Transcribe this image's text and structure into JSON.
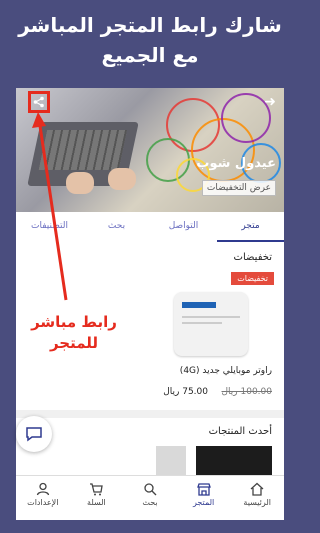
{
  "headline": {
    "line1": "شارك رابط المتجر المباشر",
    "line2": "مع الجميع"
  },
  "banner": {
    "store_name": "عيدول شوب",
    "deals_chip": "عرض التخفيضات"
  },
  "tabs": [
    {
      "label": "متجر",
      "active": true
    },
    {
      "label": "التواصل",
      "active": false
    },
    {
      "label": "بحث",
      "active": false
    },
    {
      "label": "التصنيفات",
      "active": false
    }
  ],
  "discounts": {
    "title": "تخفيضات",
    "badge": "تخفيضات",
    "product_name": "راوتر موبايلي جديد (4G)",
    "price_old": "100.00 ريال",
    "price_new": "75.00 ريال"
  },
  "latest": {
    "title": "أحدث المنتجات"
  },
  "callout": {
    "line1": "رابط مباشر",
    "line2": "للمتجر"
  },
  "bottom_nav": [
    {
      "label": "الرئيسية",
      "icon": "home-icon",
      "active": false
    },
    {
      "label": "المتجر",
      "icon": "store-icon",
      "active": true
    },
    {
      "label": "بحث",
      "icon": "search-icon",
      "active": false
    },
    {
      "label": "السلة",
      "icon": "cart-icon",
      "active": false
    },
    {
      "label": "الإعدادات",
      "icon": "user-icon",
      "active": false
    }
  ],
  "colors": {
    "background": "#4a4d7e",
    "highlight": "#e52b1e",
    "accent": "#2f3a8f",
    "badge": "#e44b3c"
  }
}
